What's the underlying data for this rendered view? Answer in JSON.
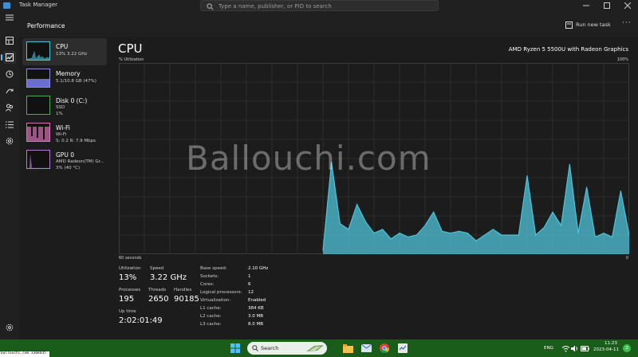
{
  "window": {
    "title": "Task Manager"
  },
  "search": {
    "placeholder": "Type a name, publisher, or PID to search"
  },
  "header": {
    "title": "Performance",
    "run_new_task": "Run new task",
    "more": "···"
  },
  "nav_icons": [
    "hamburger-icon",
    "processes-icon",
    "performance-icon",
    "app-history-icon",
    "startup-apps-icon",
    "users-icon",
    "details-icon",
    "services-icon",
    "settings-icon"
  ],
  "sidebar": {
    "items": [
      {
        "name": "CPU",
        "sub1": "13% 3.22 GHz",
        "sub2": "",
        "accent": "#4fc3d9"
      },
      {
        "name": "Memory",
        "sub1": "5.1/10.8 GB (47%)",
        "sub2": "",
        "accent": "#8d8fe0"
      },
      {
        "name": "Disk 0 (C:)",
        "sub1": "SSD",
        "sub2": "1%",
        "accent": "#4caf50"
      },
      {
        "name": "Wi-Fi",
        "sub1": "Wi-Fi",
        "sub2": "S: 0.2 R: 7.9 Mbps",
        "accent": "#d86fb5"
      },
      {
        "name": "GPU 0",
        "sub1": "AMD Radeon(TM) Gr...",
        "sub2": "3% (40 °C)",
        "accent": "#b27bd9"
      }
    ]
  },
  "main": {
    "title": "CPU",
    "model": "AMD Ryzen 5 5500U with Radeon Graphics",
    "y_label": "% Utilization",
    "y_max_label": "100%",
    "x_label": "60 seconds",
    "x_min_label": "0",
    "watermark": "Ballouchi.com"
  },
  "chart_data": {
    "type": "area",
    "xlabel": "60 seconds",
    "ylabel": "% Utilization",
    "ylim": [
      0,
      100
    ],
    "xlim": [
      0,
      60
    ],
    "grid": true,
    "color": "#4fc3d9",
    "series": [
      {
        "x": [
          24,
          25,
          26,
          27,
          28,
          29,
          30,
          31,
          32,
          33,
          34,
          35,
          36,
          37,
          38,
          39,
          40,
          41,
          42,
          43,
          44,
          45,
          46,
          47,
          48,
          49,
          50,
          51,
          52,
          53,
          54,
          55,
          56,
          57,
          58,
          59,
          60
        ],
        "values": [
          2,
          48,
          16,
          13,
          26,
          17,
          11,
          13,
          8,
          11,
          9,
          10,
          15,
          22,
          12,
          11,
          12,
          11,
          7,
          10,
          13,
          10,
          10,
          10,
          41,
          10,
          14,
          22,
          15,
          47,
          11,
          35,
          9,
          11,
          9,
          33,
          10
        ]
      }
    ]
  },
  "stats": {
    "utilization_label": "Utilization",
    "utilization": "13%",
    "speed_label": "Speed",
    "speed": "3.22 GHz",
    "processes_label": "Processes",
    "processes": "195",
    "threads_label": "Threads",
    "threads": "2650",
    "handles_label": "Handles",
    "handles": "90185",
    "uptime_label": "Up time",
    "uptime": "2:02:01:49"
  },
  "info": [
    {
      "k": "Base speed:",
      "v": "2.10 GHz"
    },
    {
      "k": "Sockets:",
      "v": "1"
    },
    {
      "k": "Cores:",
      "v": "6"
    },
    {
      "k": "Logical processors:",
      "v": "12"
    },
    {
      "k": "Virtualization:",
      "v": "Enabled"
    },
    {
      "k": "L1 cache:",
      "v": "384 KB"
    },
    {
      "k": "L2 cache:",
      "v": "3.0 MB"
    },
    {
      "k": "L3 cache:",
      "v": "8.0 MB"
    }
  ],
  "taskbar": {
    "search_label": "Search",
    "lang": "ENG",
    "time": "11:23",
    "date": "2023-04-11",
    "notification_count": "2",
    "source_badge": "ballouchi.com 3368435"
  }
}
